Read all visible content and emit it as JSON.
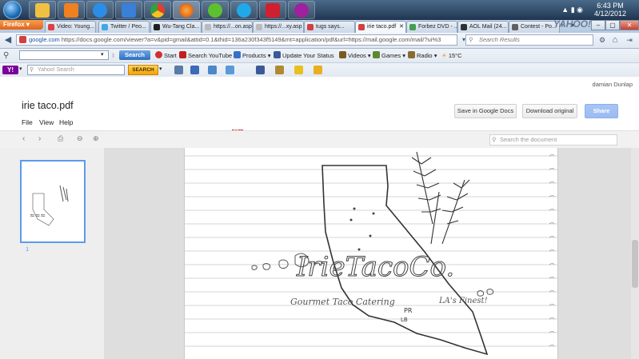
{
  "taskbar": {
    "clock_time": "6:43 PM",
    "clock_date": "4/12/2012",
    "apps": [
      {
        "name": "explorer-app",
        "color": "#f0c040"
      },
      {
        "name": "media-player-app",
        "color": "#f08020"
      },
      {
        "name": "ie-app",
        "color": "#2a8ee8"
      },
      {
        "name": "app-4",
        "color": "#3a7fd8"
      },
      {
        "name": "chrome-app",
        "color": "#e04030"
      },
      {
        "name": "firefox-app",
        "color": "#e8701a"
      },
      {
        "name": "app-7",
        "color": "#5cc030"
      },
      {
        "name": "skype-app",
        "color": "#20a8e8"
      },
      {
        "name": "app-9",
        "color": "#d02030"
      },
      {
        "name": "yahoo-messenger-app",
        "color": "#a020a0"
      }
    ]
  },
  "browser": {
    "app_button": "Firefox",
    "brand": "YAHOO!",
    "tabs": [
      {
        "label": "Video: Young...",
        "color": "#e04040"
      },
      {
        "label": "Twitter / Peo...",
        "color": "#40a8e8"
      },
      {
        "label": "Wu-Tang Cla...",
        "color": "#202020"
      },
      {
        "label": "https://...on.asp",
        "color": "#bbbbbb"
      },
      {
        "label": "https://...xy.asp",
        "color": "#bbbbbb"
      },
      {
        "label": "tugs says...",
        "color": "#d04040"
      },
      {
        "label": "irie taco.pdf",
        "color": "#d04040",
        "active": true
      },
      {
        "label": "Forbez DVD - ...",
        "color": "#40a050"
      },
      {
        "label": "AOL Mail (24...",
        "color": "#303030"
      },
      {
        "label": "Contest - Po...",
        "color": "#606060"
      }
    ],
    "url_host": "google.com",
    "url": "https://docs.google.com/viewer?a=v&pid=gmail&attid=0.1&thid=136a230f343f5149&mt=application/pdf&url=https://mail.google.com/mail/?ui%3",
    "search_placeholder": "Search Results"
  },
  "toolbar1": {
    "search_button": "Search",
    "items": [
      "Start",
      "Search YouTube",
      "Products",
      "Update Your Status",
      "Videos",
      "Games",
      "Radio",
      "15°C"
    ]
  },
  "toolbar2": {
    "search_placeholder": "Yahoo! Search",
    "search_button": "SEARCH",
    "badge": "99+"
  },
  "docs": {
    "user": "damian Dunlap",
    "title": "irie taco.pdf",
    "menu": [
      "File",
      "View",
      "Help"
    ],
    "save_button": "Save in Google Docs",
    "download_button": "Download original",
    "share_button": "Share",
    "search_placeholder": "Search the document",
    "page_number": "1"
  },
  "drawing": {
    "logo_text": "IrieTacoCo.",
    "tagline": "Gourmet Taco Catering",
    "tagline_suffix": "LA's Finest!",
    "marks": [
      "PR",
      "LB"
    ]
  }
}
